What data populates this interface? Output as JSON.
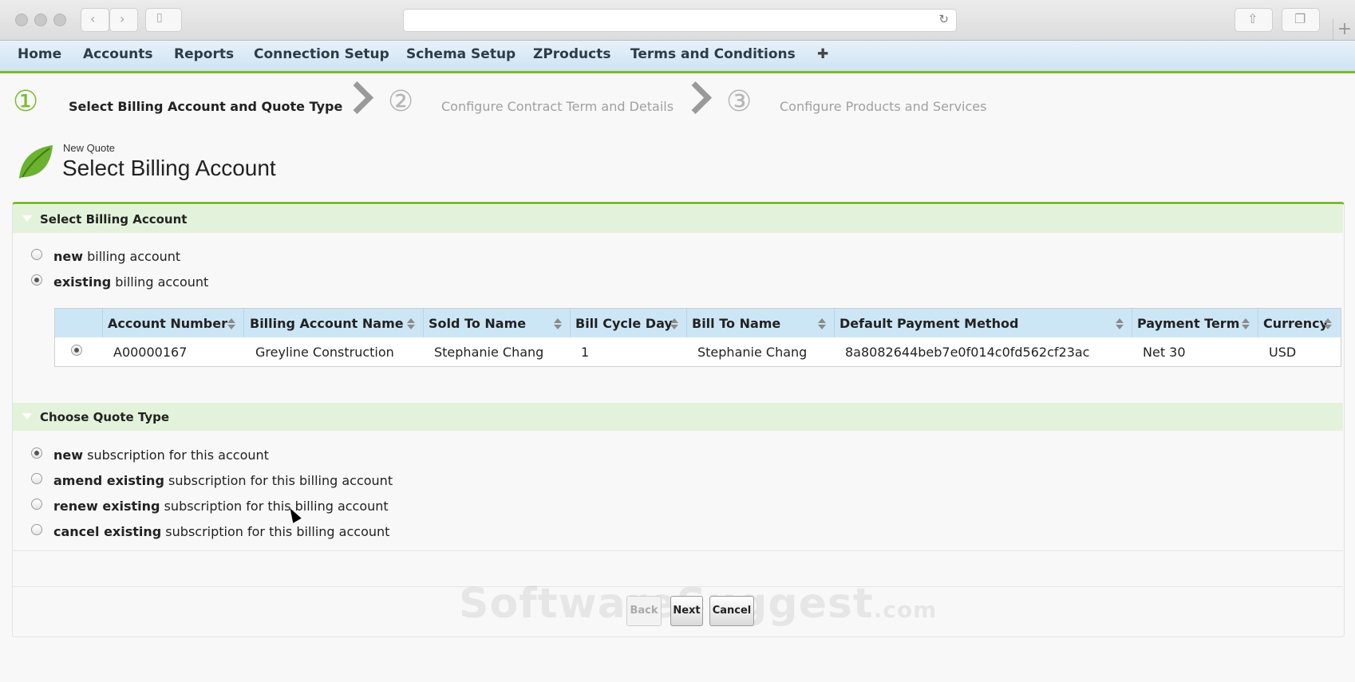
{
  "browser": {
    "url": "",
    "icons": {
      "back": "chevron-left-icon",
      "forward": "chevron-right-icon",
      "sidebar": "sidebar-icon",
      "reload": "reload-icon",
      "share": "share-icon",
      "tabs": "tabs-icon",
      "new_tab": "plus-icon"
    }
  },
  "nav": {
    "items": [
      "Home",
      "Accounts",
      "Reports",
      "Connection Setup",
      "Schema Setup",
      "ZProducts",
      "Terms and Conditions"
    ],
    "more": "✚"
  },
  "steps": [
    {
      "number": "①",
      "label": "Select Billing Account and Quote Type",
      "active": true
    },
    {
      "number": "②",
      "label": "Configure Contract Term and Details",
      "active": false
    },
    {
      "number": "③",
      "label": "Configure Products and Services",
      "active": false
    }
  ],
  "page": {
    "subtitle": "New Quote",
    "title": "Select Billing Account"
  },
  "billing_section": {
    "title": "Select Billing Account",
    "options": [
      {
        "bold": "new",
        "rest": " billing account",
        "selected": false
      },
      {
        "bold": "existing",
        "rest": " billing account",
        "selected": true
      }
    ]
  },
  "table": {
    "headers": [
      "Account Number",
      "Billing Account Name",
      "Sold To Name",
      "Bill Cycle Day",
      "Bill To Name",
      "Default Payment Method",
      "Payment Term",
      "Currency"
    ],
    "rows": [
      [
        "A00000167",
        "Greyline Construction",
        "Stephanie Chang",
        "1",
        "Stephanie Chang",
        "8a8082644beb7e0f014c0fd562cf23ac",
        "Net 30",
        "USD"
      ]
    ]
  },
  "quote_section": {
    "title": "Choose Quote Type",
    "options": [
      {
        "bold": "new",
        "rest": " subscription for this account",
        "selected": true
      },
      {
        "bold": "amend existing",
        "rest": " subscription for this billing account",
        "selected": false
      },
      {
        "bold": "renew existing",
        "rest": " subscription for this billing account",
        "selected": false
      },
      {
        "bold": "cancel existing",
        "rest": " subscription for this billing account",
        "selected": false
      }
    ]
  },
  "buttons": {
    "back": "Back",
    "next": "Next",
    "cancel": "Cancel"
  },
  "watermark": {
    "main": "SoftwareSuggest",
    "suffix": ".com"
  },
  "colors": {
    "accent": "#7cbb2e",
    "nav_bg": "#cfe3f2",
    "section_bg": "#e3f3db",
    "table_header": "#cde6f6"
  }
}
